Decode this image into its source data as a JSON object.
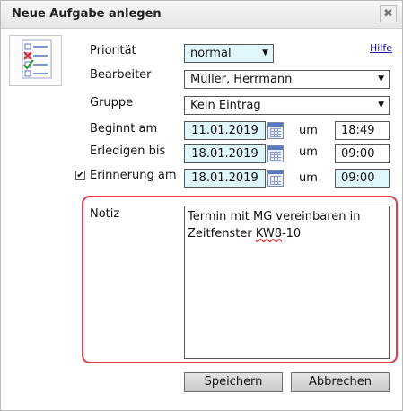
{
  "dialog": {
    "title": "Neue Aufgabe anlegen",
    "close_glyph": "✖"
  },
  "icons": {
    "close": "close-icon",
    "task_logo": "task-checklist-icon",
    "calendar": "calendar-icon",
    "dropdown": "chevron-down-icon",
    "checkbox": "checkmark-icon"
  },
  "colors": {
    "field_highlight": "#dff6fb",
    "note_highlight_border": "#e23a4a",
    "help_link": "#1a1aa6"
  },
  "form": {
    "help_link": "Hilfe",
    "priority": {
      "label": "Priorität",
      "value": "normal",
      "arrow": "▼"
    },
    "assignee": {
      "label": "Bearbeiter",
      "value": "Müller, Herrmann",
      "arrow": "▼"
    },
    "group": {
      "label": "Gruppe",
      "value": "Kein Eintrag",
      "arrow": "▼"
    },
    "start": {
      "label": "Beginnt am",
      "date": "11.01.2019",
      "at_label": "um",
      "time": "18:49"
    },
    "due": {
      "label": "Erledigen bis",
      "date": "18.01.2019",
      "at_label": "um",
      "time": "09:00"
    },
    "reminder": {
      "label": "Erinnerung am",
      "checked": true,
      "check_glyph": "✔",
      "date": "18.01.2019",
      "at_label": "um",
      "time": "09:00"
    },
    "note": {
      "label": "Notiz",
      "line1": "Termin mit MG vereinbaren in",
      "line2_prefix": "Zeitfenster ",
      "line2_flagged": "KW8",
      "line2_suffix": "-10"
    }
  },
  "buttons": {
    "save": "Speichern",
    "cancel": "Abbrechen"
  }
}
